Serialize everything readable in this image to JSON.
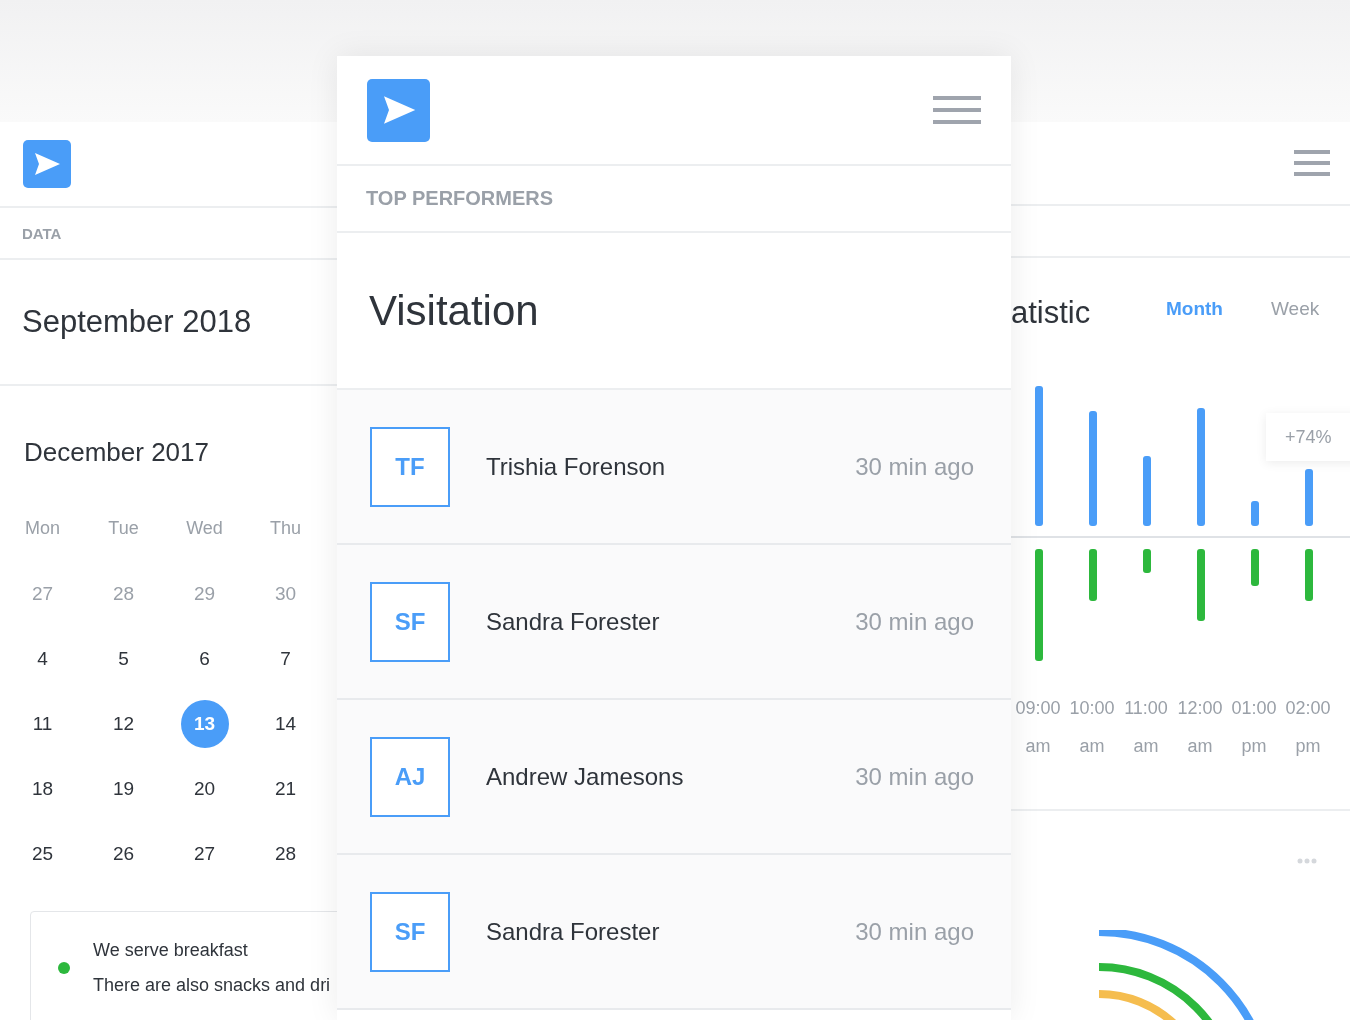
{
  "left_panel": {
    "section_label": "DATA",
    "title": "September 2018",
    "calendar": {
      "month": "December 2017",
      "weekdays": [
        "Mon",
        "Tue",
        "Wed",
        "Thu"
      ],
      "weeks": [
        [
          {
            "day": "27",
            "muted": true,
            "selected": false
          },
          {
            "day": "28",
            "muted": true,
            "selected": false
          },
          {
            "day": "29",
            "muted": true,
            "selected": false
          },
          {
            "day": "30",
            "muted": true,
            "selected": false
          }
        ],
        [
          {
            "day": "4",
            "muted": false,
            "selected": false
          },
          {
            "day": "5",
            "muted": false,
            "selected": false
          },
          {
            "day": "6",
            "muted": false,
            "selected": false
          },
          {
            "day": "7",
            "muted": false,
            "selected": false
          }
        ],
        [
          {
            "day": "11",
            "muted": false,
            "selected": false
          },
          {
            "day": "12",
            "muted": false,
            "selected": false
          },
          {
            "day": "13",
            "muted": false,
            "selected": true
          },
          {
            "day": "14",
            "muted": false,
            "selected": false
          }
        ],
        [
          {
            "day": "18",
            "muted": false,
            "selected": false
          },
          {
            "day": "19",
            "muted": false,
            "selected": false
          },
          {
            "day": "20",
            "muted": false,
            "selected": false
          },
          {
            "day": "21",
            "muted": false,
            "selected": false
          }
        ],
        [
          {
            "day": "25",
            "muted": false,
            "selected": false
          },
          {
            "day": "26",
            "muted": false,
            "selected": false
          },
          {
            "day": "27",
            "muted": false,
            "selected": false
          },
          {
            "day": "28",
            "muted": false,
            "selected": false
          }
        ]
      ]
    },
    "note": {
      "title": "We serve breakfast",
      "text": "There are also snacks and dri"
    }
  },
  "middle_panel": {
    "section_label": "TOP PERFORMERS",
    "title": "Visitation",
    "performers": [
      {
        "initials": "TF",
        "name": "Trishia Forenson",
        "time": "30 min ago"
      },
      {
        "initials": "SF",
        "name": "Sandra Forester",
        "time": "30 min ago"
      },
      {
        "initials": "AJ",
        "name": "Andrew Jamesons",
        "time": "30 min ago"
      },
      {
        "initials": "SF",
        "name": "Sandra Forester",
        "time": "30 min ago"
      }
    ]
  },
  "right_panel": {
    "title": "atistic",
    "tabs": [
      {
        "label": "Month",
        "selected": true
      },
      {
        "label": "Week",
        "selected": false
      }
    ],
    "badge": "+74%",
    "time_labels": [
      {
        "time": "09:00",
        "period": "am"
      },
      {
        "time": "10:00",
        "period": "am"
      },
      {
        "time": "11:00",
        "period": "am"
      },
      {
        "time": "12:00",
        "period": "am"
      },
      {
        "time": "01:00",
        "period": "pm"
      },
      {
        "time": "02:00",
        "period": "pm"
      }
    ]
  }
}
